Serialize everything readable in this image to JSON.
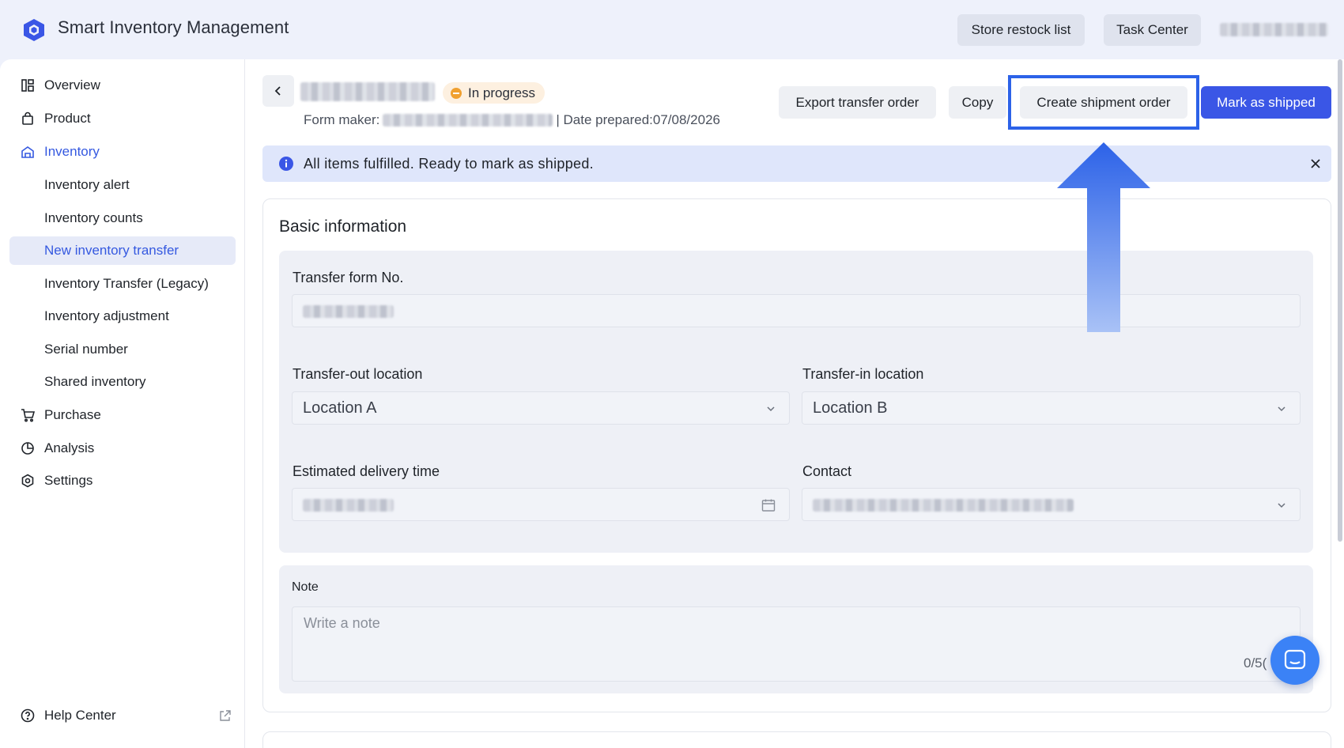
{
  "app": {
    "title": "Smart Inventory Management"
  },
  "header": {
    "restock_label": "Store restock list",
    "task_center_label": "Task Center"
  },
  "sidebar": {
    "items": [
      {
        "label": "Overview"
      },
      {
        "label": "Product"
      },
      {
        "label": "Inventory"
      },
      {
        "label": "Inventory alert"
      },
      {
        "label": "Inventory counts"
      },
      {
        "label": "New inventory transfer"
      },
      {
        "label": "Inventory Transfer (Legacy)"
      },
      {
        "label": "Inventory adjustment"
      },
      {
        "label": "Serial number"
      },
      {
        "label": "Shared inventory"
      },
      {
        "label": "Purchase"
      },
      {
        "label": "Analysis"
      },
      {
        "label": "Settings"
      }
    ],
    "help_label": "Help Center"
  },
  "order": {
    "status": "In progress",
    "form_maker_label": "Form maker:",
    "date_prefix": "| Date prepared:",
    "date": "07/08/2026"
  },
  "actions": {
    "export": "Export transfer order",
    "copy": "Copy",
    "create_shipment": "Create shipment order",
    "mark_shipped": "Mark as shipped"
  },
  "alert": {
    "message": "All items fulfilled. Ready to mark as shipped."
  },
  "basic_info": {
    "title": "Basic information",
    "transfer_no_label": "Transfer form No.",
    "transfer_out_label": "Transfer-out location",
    "transfer_out_value": "Location A",
    "transfer_in_label": "Transfer-in location",
    "transfer_in_value": "Location B",
    "delivery_label": "Estimated delivery time",
    "contact_label": "Contact"
  },
  "note": {
    "label": "Note",
    "placeholder": "Write a note",
    "count": "0/5("
  },
  "colors": {
    "accent": "#3a56e6",
    "highlight": "#2c62e8",
    "status_dot": "#f0a030",
    "alert_bg": "#dfe6fb"
  }
}
